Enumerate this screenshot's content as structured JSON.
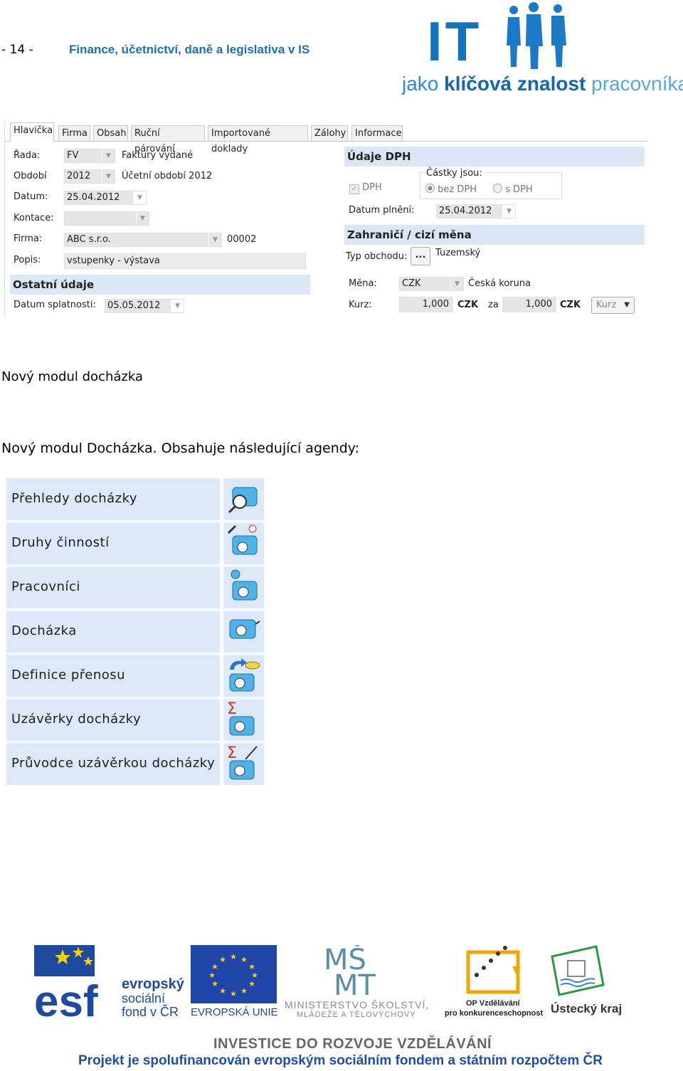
{
  "header": {
    "page_number": "- 14 -",
    "title": "Finance, účetnictví, daně a legislativa v IS",
    "logo_main": "IT",
    "logo_sub_1": "jako",
    "logo_sub_2": "klíčová znalost",
    "logo_sub_3": "pracovníka"
  },
  "form": {
    "tabs": [
      "Hlavička",
      "Firma",
      "Obsah",
      "Ruční párování",
      "Importované doklady",
      "Zálohy",
      "Informace"
    ],
    "left": {
      "rada_label": "Řada:",
      "rada_value": "FV",
      "rada_text": "Faktury vydané",
      "obdobi_label": "Období",
      "obdobi_value": "2012",
      "obdobi_text": "Účetní období 2012",
      "datum_label": "Datum:",
      "datum_value": "25.04.2012",
      "kontace_label": "Kontace:",
      "kontace_value": "",
      "firma_label": "Firma:",
      "firma_value": "ABC s.r.o.",
      "firma_code": "00002",
      "popis_label": "Popis:",
      "popis_value": "vstupenky - výstava",
      "ostatni_title": "Ostatní údaje",
      "splatnost_label": "Datum splatnosti:",
      "splatnost_value": "05.05.2012"
    },
    "right": {
      "dph_title": "Údaje DPH",
      "dph_checkbox": "DPH",
      "castky_label": "Částky jsou:",
      "bez_dph": "bez DPH",
      "s_dph": "s DPH",
      "plneni_label": "Datum plnění:",
      "plneni_value": "25.04.2012",
      "zahranici_title": "Zahraničí / cizí měna",
      "typ_label": "Typ obchodu:",
      "typ_button": "...",
      "typ_value": "Tuzemský",
      "mena_label": "Měna:",
      "mena_value": "CZK",
      "mena_text": "Česká koruna",
      "kurz_label": "Kurz:",
      "kurz_value1": "1,000",
      "kurz_cur1": "CZK",
      "kurz_za": "za",
      "kurz_value2": "1,000",
      "kurz_cur2": "CZK",
      "kurz_button": "Kurz"
    }
  },
  "section_heading": "Nový modul docházka",
  "intro": "Nový modul Docházka. Obsahuje následující agendy:",
  "menu_items": [
    {
      "label": "Přehledy docházky",
      "icon": "attendance-overview-icon"
    },
    {
      "label": "Druhy činností",
      "icon": "activity-types-icon"
    },
    {
      "label": "Pracovníci",
      "icon": "workers-icon"
    },
    {
      "label": "Docházka",
      "icon": "attendance-icon"
    },
    {
      "label": "Definice přenosu",
      "icon": "transfer-definition-icon"
    },
    {
      "label": "Uzávěrky docházky",
      "icon": "attendance-closing-icon"
    },
    {
      "label": "Průvodce uzávěrkou docházky",
      "icon": "closing-wizard-icon"
    }
  ],
  "footer": {
    "esf_1": "evropský",
    "esf_2": "sociální",
    "esf_3": "fond v ČR",
    "eu": "EVROPSKÁ UNIE",
    "msmt_1": "MINISTERSTVO ŠKOLSTVÍ,",
    "msmt_2": "MLÁDEŽE A TĚLOVÝCHOVY",
    "op_1": "OP Vzdělávání",
    "op_2": "pro konkurenceschopnost",
    "kraj": "Ústecký kraj",
    "investice": "INVESTICE DO ROZVOJE VZDĚLÁVÁNÍ",
    "project_text": "Projekt je spolufinancován evropským sociálním fondem a státním rozpočtem ČR"
  },
  "colors": {
    "accent_blue": "#1f6fb5",
    "menu_bg": "#dde9f8",
    "section_bar": "#dbe7f6"
  }
}
